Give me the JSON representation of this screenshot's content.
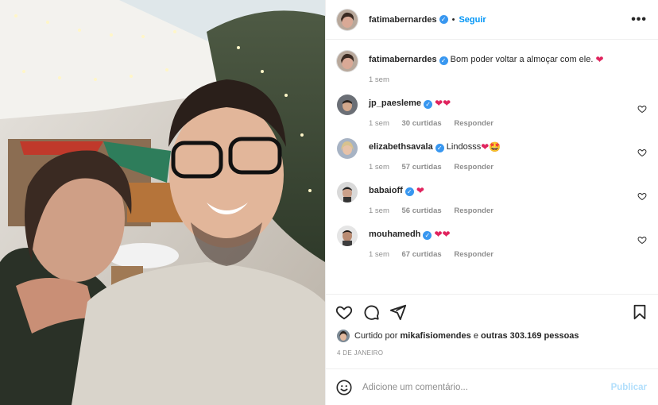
{
  "post": {
    "author": "fatimabernardes",
    "follow_label": "Seguir",
    "caption_author": "fatimabernardes",
    "caption_text": "Bom poder voltar a almoçar com ele.",
    "caption_emoji": "❤",
    "caption_time": "1 sem"
  },
  "comments": [
    {
      "user": "jp_paesleme",
      "text": "",
      "emoji": "❤❤",
      "time": "1 sem",
      "likes": "30 curtidas",
      "reply": "Responder"
    },
    {
      "user": "elizabethsavala",
      "text": "Lindosss",
      "emoji": "❤🤩",
      "time": "1 sem",
      "likes": "57 curtidas",
      "reply": "Responder"
    },
    {
      "user": "babaioff",
      "text": "",
      "emoji": "❤",
      "time": "1 sem",
      "likes": "56 curtidas",
      "reply": "Responder"
    },
    {
      "user": "mouhamedh",
      "text": "",
      "emoji": "❤❤",
      "time": "1 sem",
      "likes": "67 curtidas",
      "reply": "Responder"
    }
  ],
  "likes_line": {
    "prefix": "Curtido por",
    "user": "mikafisiomendes",
    "middle": "e",
    "rest": "outras 303.169 pessoas"
  },
  "date": "4 DE JANEIRO",
  "add_comment": {
    "placeholder": "Adicione um comentário...",
    "publish_label": "Publicar"
  },
  "colors": {
    "link_blue": "#0095f6",
    "verified_blue": "#3897f0",
    "heart_red": "#e0245e",
    "publish_disabled": "#b2dffc"
  }
}
